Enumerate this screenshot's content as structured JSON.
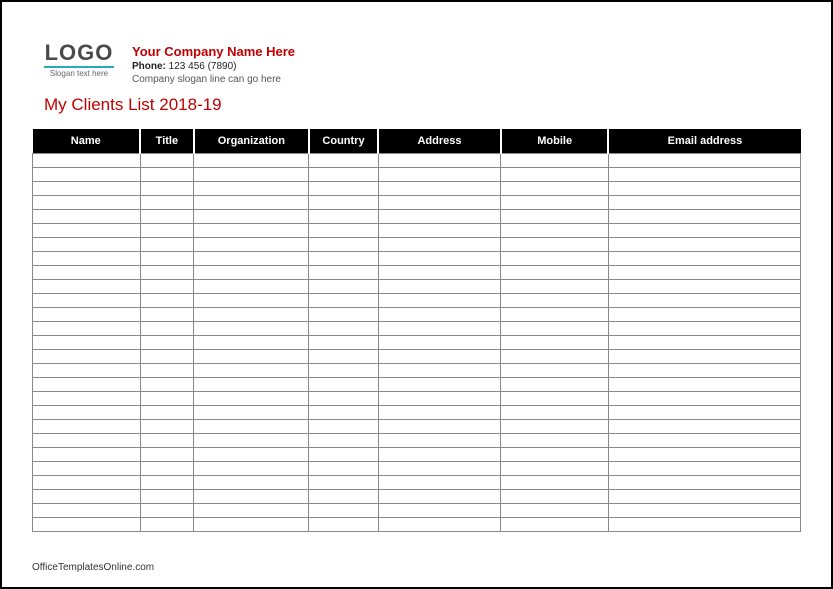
{
  "logo": {
    "text": "LOGO",
    "slogan": "Slogan text here"
  },
  "company": {
    "name": "Your Company Name Here",
    "phone_label": "Phone:",
    "phone_value": "123 456 (7890)",
    "slogan_line": "Company slogan line can go here"
  },
  "list_title": "My Clients List 2018-19",
  "columns": [
    {
      "label": "Name",
      "width": "14%"
    },
    {
      "label": "Title",
      "width": "7%"
    },
    {
      "label": "Organization",
      "width": "15%"
    },
    {
      "label": "Country",
      "width": "9%"
    },
    {
      "label": "Address",
      "width": "16%"
    },
    {
      "label": "Mobile",
      "width": "14%"
    },
    {
      "label": "Email address",
      "width": "25%"
    }
  ],
  "row_count": 27,
  "footer": "OfficeTemplatesOnline.com"
}
